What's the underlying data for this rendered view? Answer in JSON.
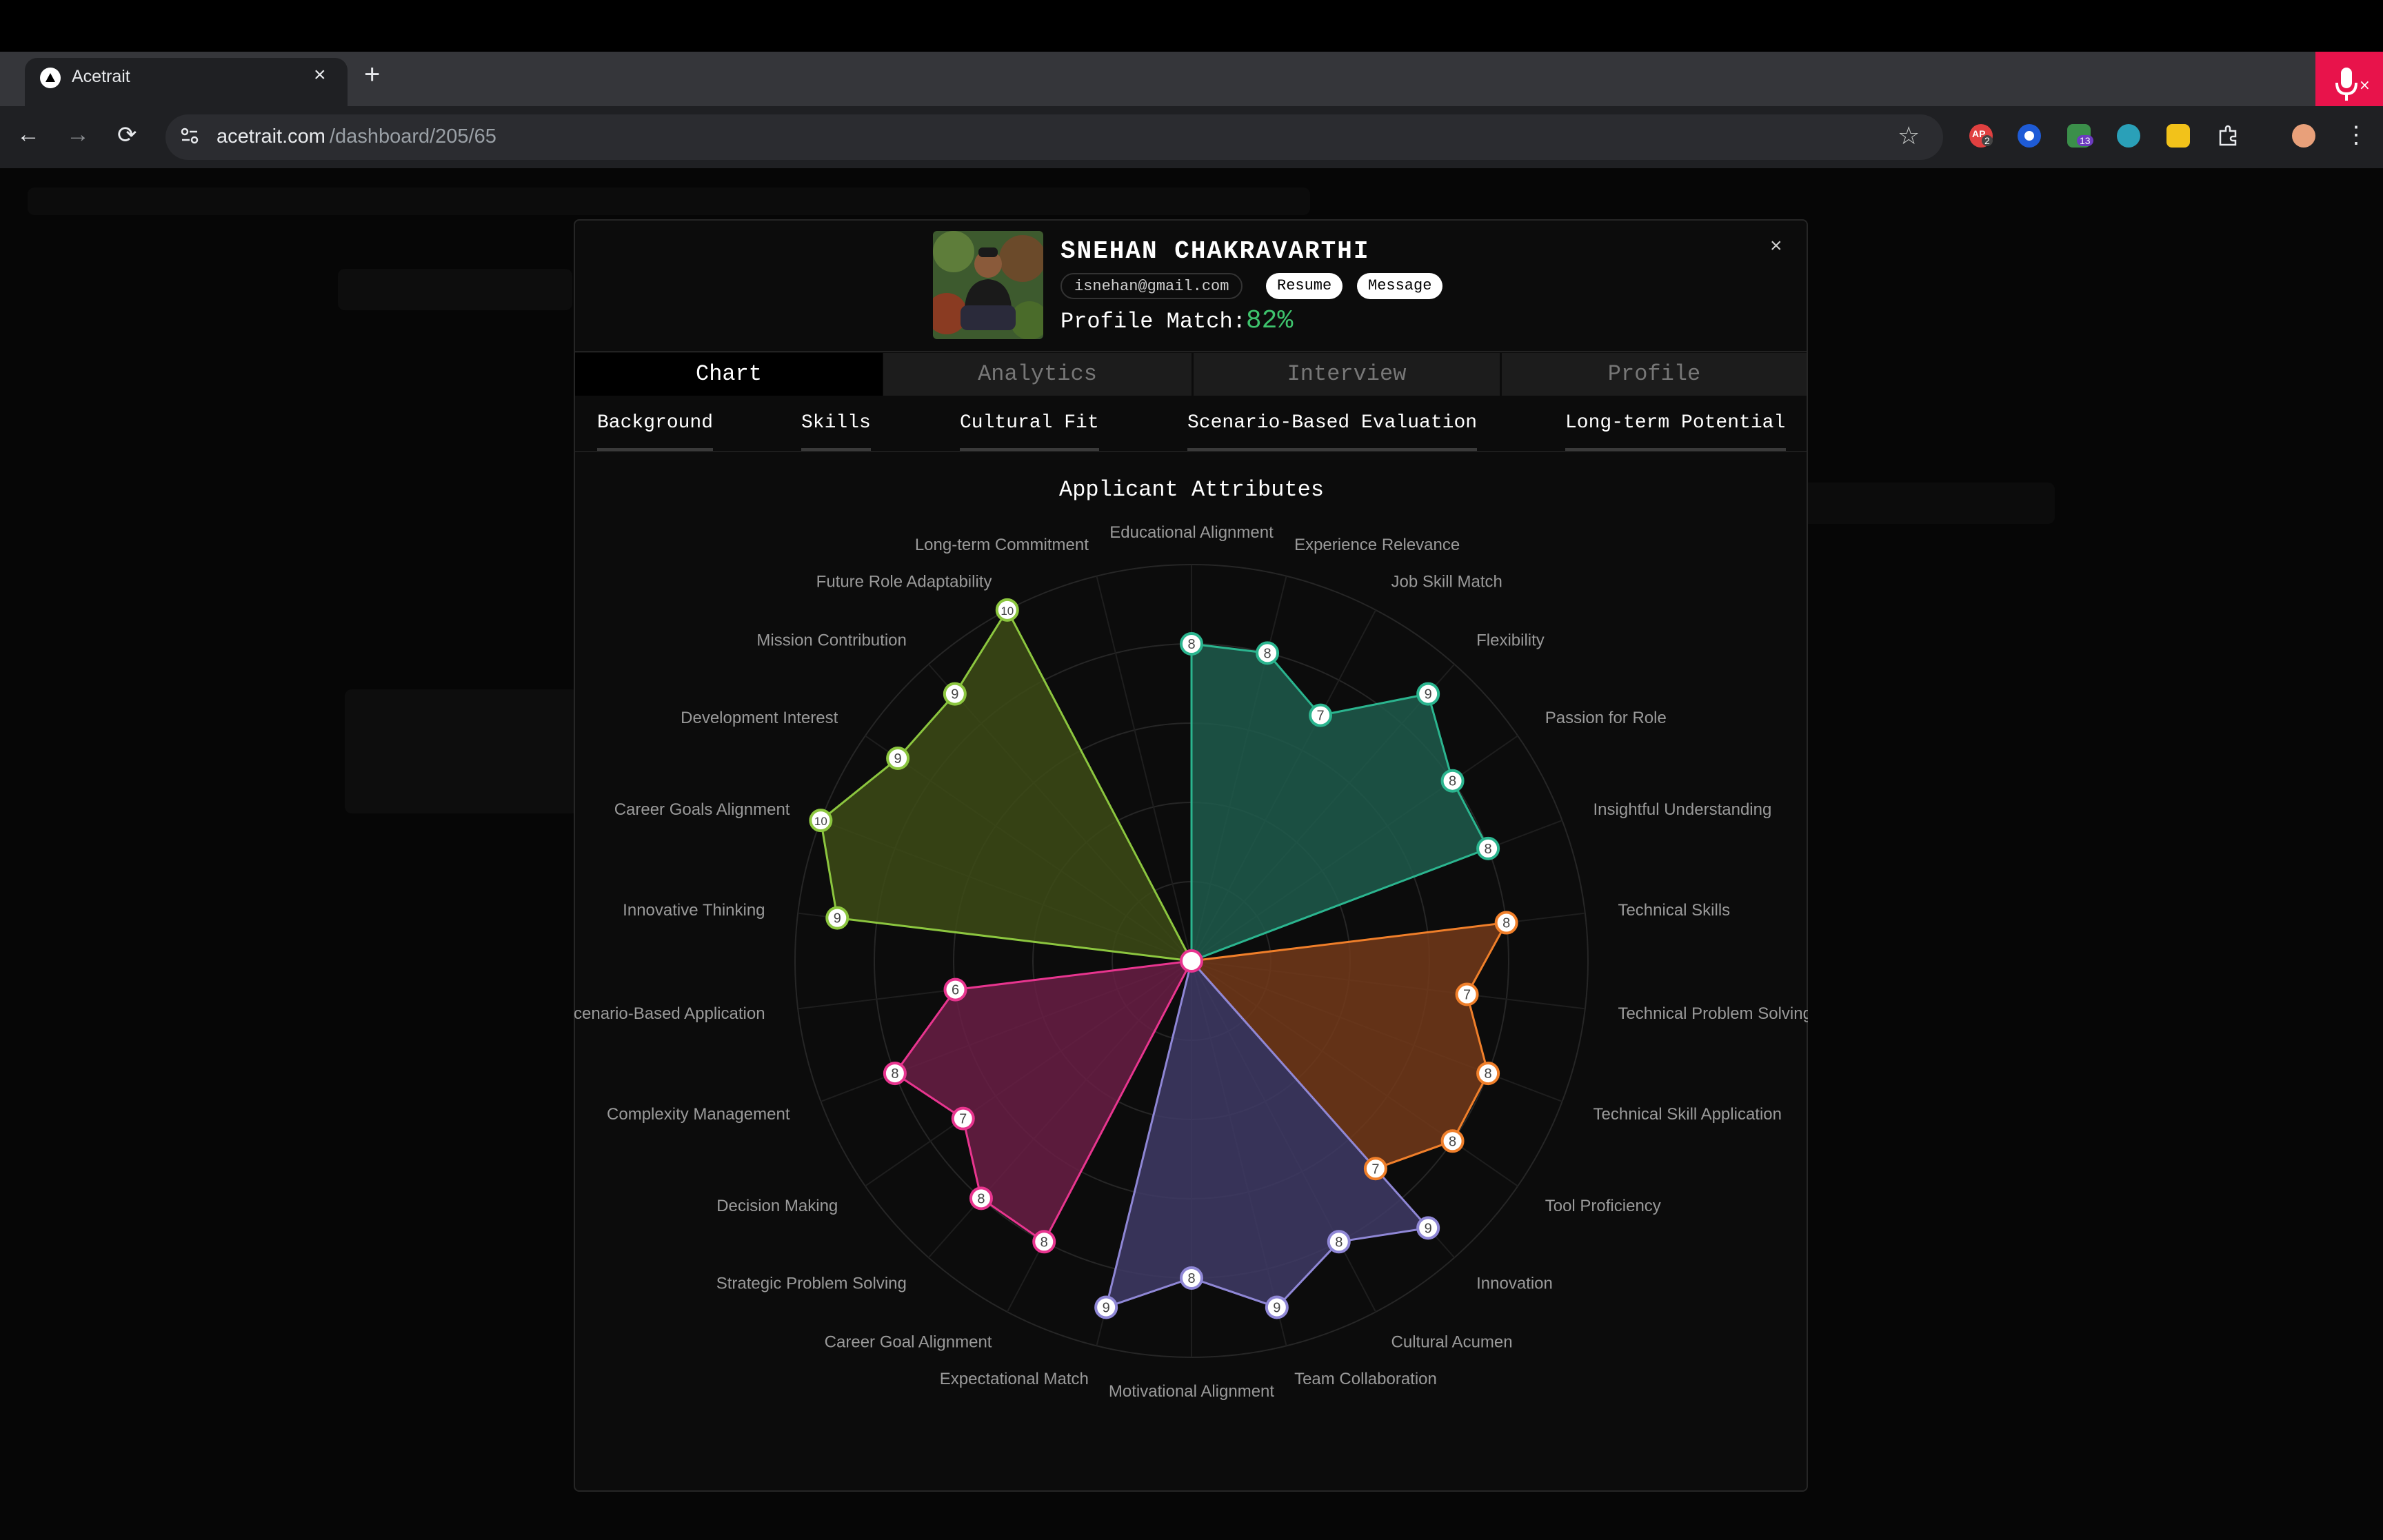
{
  "browser": {
    "tab_title": "Acetrait",
    "tab_close": "×",
    "new_tab": "+",
    "url_host": "acetrait.com",
    "url_path": "/dashboard/205/65",
    "back": "←",
    "forward": "→",
    "reload": "⟳",
    "star": "☆",
    "menu": "⋮",
    "ext_badges": [
      "2",
      "13"
    ],
    "ext_ap_label": "AP"
  },
  "candidate": {
    "name": "SNEHAN CHAKRAVARTHI",
    "email": "isnehan@gmail.com",
    "resume_label": "Resume",
    "message_label": "Message",
    "match_label": "Profile Match:",
    "match_value": "82%"
  },
  "close_label": "×",
  "tabs": [
    {
      "label": "Chart",
      "active": true
    },
    {
      "label": "Analytics",
      "active": false
    },
    {
      "label": "Interview",
      "active": false
    },
    {
      "label": "Profile",
      "active": false
    }
  ],
  "subtabs": [
    "Background",
    "Skills",
    "Cultural Fit",
    "Scenario-Based Evaluation",
    "Long-term Potential"
  ],
  "chart_data": {
    "type": "radar",
    "title": "Applicant Attributes",
    "rmax": 10,
    "grid_rings": 5,
    "axes": [
      "Educational Alignment",
      "Experience Relevance",
      "Job Skill Match",
      "Flexibility",
      "Passion for Role",
      "Insightful Understanding",
      "Technical Skills",
      "Technical Problem Solving",
      "Technical Skill Application",
      "Tool Proficiency",
      "Innovation",
      "Cultural Acumen",
      "Team Collaboration",
      "Motivational Alignment",
      "Expectational Match",
      "Career Goal Alignment",
      "Strategic Problem Solving",
      "Decision Making",
      "Complexity Management",
      "Scenario-Based Application",
      "Innovative Thinking",
      "Career Goals Alignment",
      "Development Interest",
      "Mission Contribution",
      "Future Role Adaptability",
      "Long-term Commitment"
    ],
    "series": [
      {
        "name": "Background",
        "color": "#2bb58f",
        "fill": "#1f5c4c",
        "axis_start": 0,
        "values": [
          8,
          8,
          7,
          9,
          8,
          8
        ]
      },
      {
        "name": "Skills",
        "color": "#f07f2a",
        "fill": "#73391a",
        "axis_start": 6,
        "values": [
          8,
          7,
          8,
          8,
          7
        ]
      },
      {
        "name": "Cultural Fit",
        "color": "#8f87d6",
        "fill": "#3f3b66",
        "axis_start": 10,
        "values": [
          9,
          8,
          9,
          8,
          9
        ]
      },
      {
        "name": "Scenario-Based Evaluation",
        "color": "#e8358f",
        "fill": "#6a1e45",
        "axis_start": 15,
        "values": [
          8,
          8,
          7,
          8,
          6
        ]
      },
      {
        "name": "Long-term Potential",
        "color": "#8cc63f",
        "fill": "#3d4b16",
        "axis_start": 20,
        "values": [
          9,
          10,
          9,
          9,
          10
        ]
      }
    ]
  }
}
